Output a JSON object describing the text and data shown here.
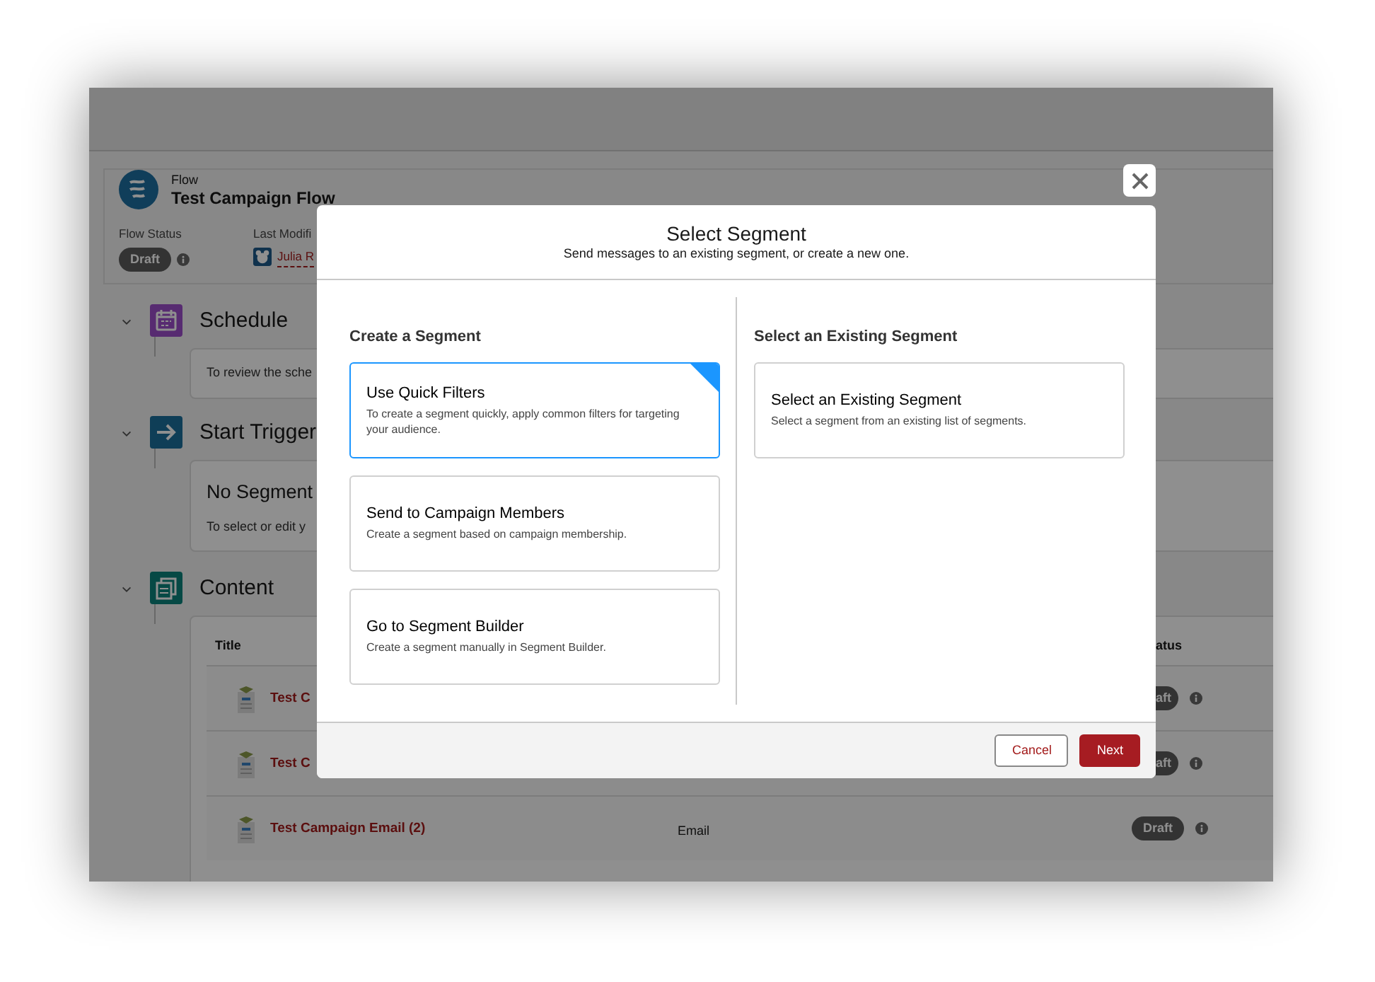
{
  "record": {
    "object_type": "Flow",
    "title": "Test Campaign Flow",
    "fields": [
      {
        "label": "Flow Status",
        "value": "Draft",
        "kind": "badge"
      },
      {
        "label": "Last Modifi",
        "value": "Julia R",
        "kind": "user"
      }
    ]
  },
  "sections": [
    {
      "title": "Schedule",
      "kind": "calendar",
      "body_text": "To review the sche"
    },
    {
      "title": "Start Trigger",
      "kind": "arrow",
      "heading": "No Segment",
      "body_text": "To select or edit y"
    },
    {
      "title": "Content",
      "kind": "content",
      "table": {
        "columns": [
          "Title",
          "atus"
        ],
        "rows": [
          {
            "title": "Test C",
            "status": "aft"
          },
          {
            "title": "Test C",
            "status": "aft"
          },
          {
            "title": "Test Campaign Email (2)",
            "type": "Email",
            "status": "Draft"
          }
        ]
      }
    }
  ],
  "dialog": {
    "title": "Select Segment",
    "subtitle": "Send messages to an existing segment, or create a new one.",
    "columns": [
      {
        "heading": "Create a Segment",
        "options": [
          {
            "title": "Use Quick Filters",
            "description": "To create a segment quickly, apply common filters for targeting your audience.",
            "selected": true
          },
          {
            "title": "Send to Campaign Members",
            "description": "Create a segment based on campaign membership.",
            "selected": false
          },
          {
            "title": "Go to Segment Builder",
            "description": "Create a segment manually in Segment Builder.",
            "selected": false
          }
        ]
      },
      {
        "heading": "Select an Existing Segment",
        "options": [
          {
            "title": "Select an Existing Segment",
            "description": "Select a segment from an existing list of segments.",
            "selected": false
          }
        ]
      }
    ],
    "buttons": [
      {
        "label": "Cancel",
        "kind": "neutral"
      },
      {
        "label": "Next",
        "kind": "brand"
      }
    ]
  }
}
